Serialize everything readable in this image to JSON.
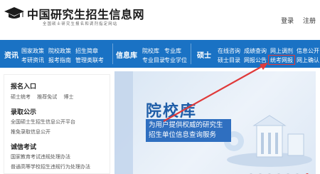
{
  "header": {
    "title": "中国研究生招生信息网",
    "subtitle": "全国硕士研究生报名和调剂指定网站",
    "links": [
      "登录",
      "注册"
    ]
  },
  "nav": {
    "sections": [
      {
        "label": "资讯",
        "links": [
          [
            "国家政策",
            "院校政策",
            "招生简章"
          ],
          [
            "考研资讯",
            "报考指南",
            "管理类联考"
          ]
        ]
      },
      {
        "label": "信息库",
        "links": [
          [
            "院校库",
            "专业库"
          ],
          [
            "专业目录",
            "专业学位"
          ]
        ]
      },
      {
        "label": "硕士",
        "links": [
          [
            "在线咨询",
            "成绩查询",
            "网上调剂",
            "信息公开"
          ],
          [
            "硕士目录",
            "网报公告",
            "统考网报",
            "网上确认"
          ]
        ]
      }
    ]
  },
  "left_panel": {
    "groups": [
      {
        "heading": "报名入口",
        "items": [
          [
            "硕士统考",
            "推荐免试",
            "博士"
          ]
        ]
      },
      {
        "heading": "录取公示",
        "items": [
          [
            "全国硕士生招生信息公开平台"
          ],
          [
            "推免录取信息公开"
          ]
        ]
      },
      {
        "heading": "诚信考试",
        "items": [
          [
            "国家教育考试违规处理办法"
          ],
          [
            "普通高等学校招生违规行为处理办法"
          ]
        ]
      }
    ]
  },
  "banner": {
    "title": "院校库",
    "subtitle": "为用户提供权威的研究生招生单位信息查询服务"
  },
  "colors": {
    "nav_bg": "#1a72c4",
    "highlight": "#e03a3a",
    "banner_title": "#1f5ea8"
  }
}
